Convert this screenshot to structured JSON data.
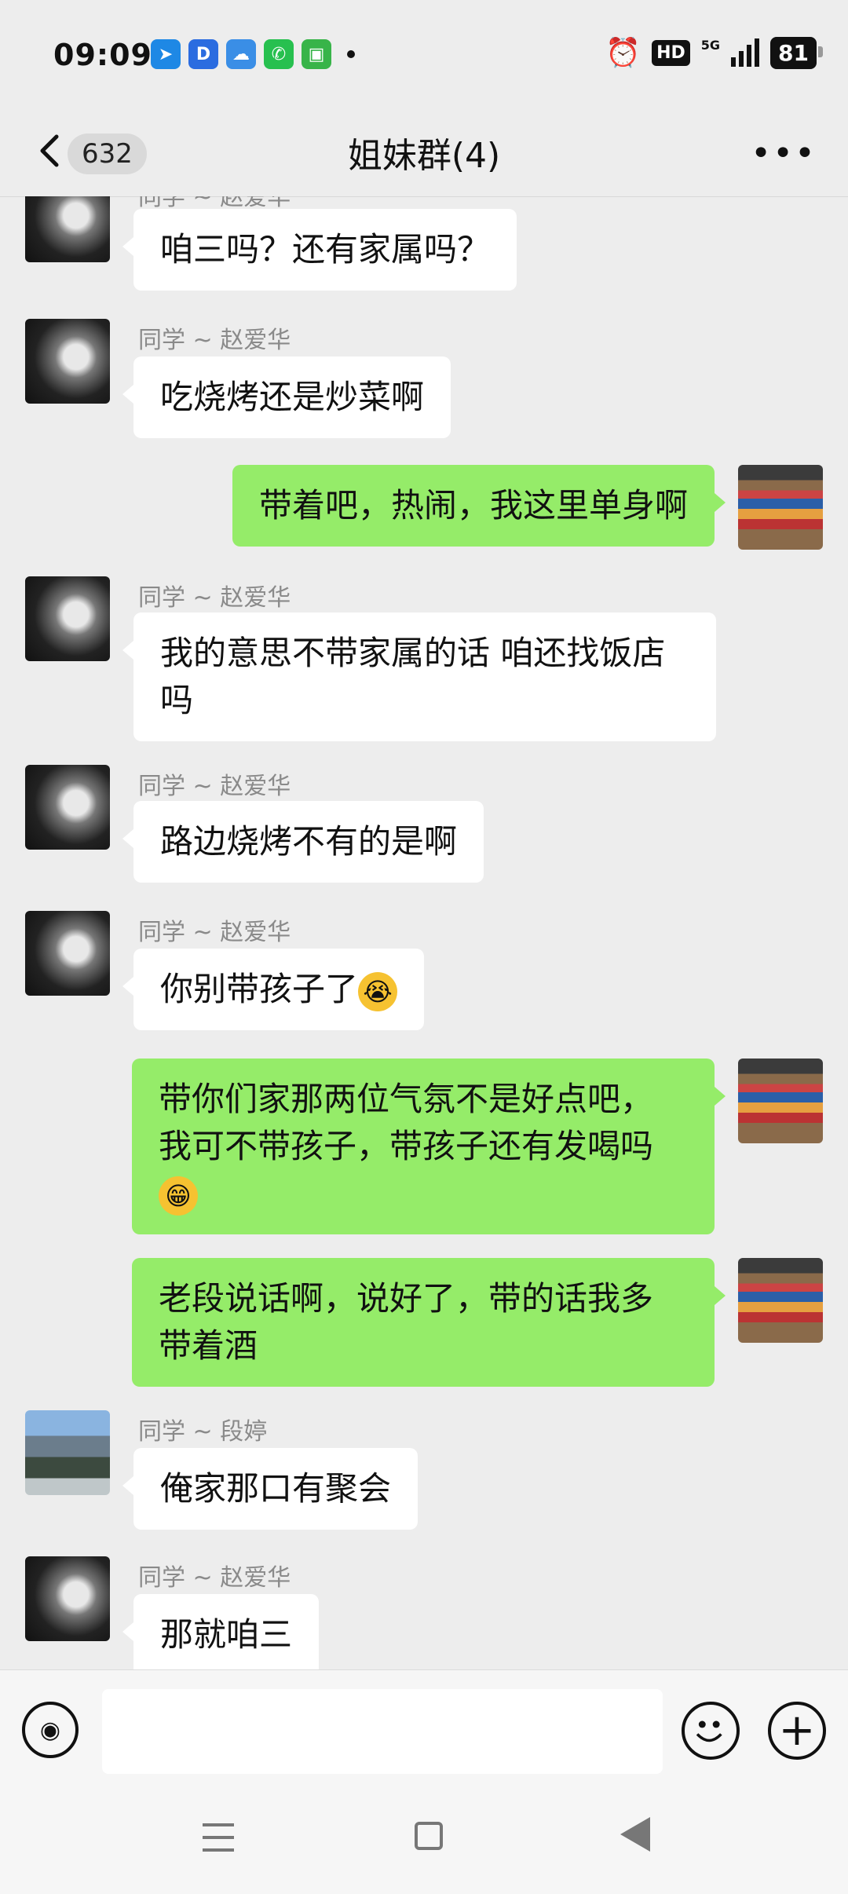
{
  "status_bar": {
    "time": "09:09",
    "network": "5G",
    "hd_label": "HD",
    "battery": "81"
  },
  "header": {
    "unread_count": "632",
    "title": "姐妹群(4)"
  },
  "messages": [
    {
      "side": "in",
      "sender": "同学 ~ 赵爱华",
      "text": "咱三吗？还有家属吗？",
      "avatar": "dark-portrait"
    },
    {
      "side": "in",
      "sender": "同学 ~ 赵爱华",
      "text": "吃烧烤还是炒菜啊",
      "avatar": "dark-portrait"
    },
    {
      "side": "out",
      "text": "带着吧，热闹，我这里单身啊",
      "avatar": "store-shelf"
    },
    {
      "side": "in",
      "sender": "同学 ~ 赵爱华",
      "text_line1": "我的意思不带家属的话 咱还找饭店",
      "text_line2": "吗",
      "avatar": "dark-portrait"
    },
    {
      "side": "in",
      "sender": "同学 ~ 赵爱华",
      "text": "路边烧烤不有的是啊",
      "avatar": "dark-portrait"
    },
    {
      "side": "in",
      "sender": "同学 ~ 赵爱华",
      "text": "你别带孩子了",
      "emoji": "😭",
      "avatar": "dark-portrait"
    },
    {
      "side": "out",
      "text_line1": "带你们家那两位气氛不是好点吧，",
      "text_line2": "我可不带孩子，带孩子还有发喝吗",
      "emoji": "😁",
      "avatar": "store-shelf"
    },
    {
      "side": "out",
      "text_line1": "老段说话啊，说好了，带的话我多",
      "text_line2": "带着酒",
      "avatar": "store-shelf"
    },
    {
      "side": "in",
      "sender": "同学 ~ 段婷",
      "text": "俺家那口有聚会",
      "avatar": "tree-landscape"
    },
    {
      "side": "in",
      "sender": "同学 ~ 赵爱华",
      "text": "那就咱三",
      "avatar": "dark-portrait"
    }
  ],
  "input_bar": {
    "placeholder": ""
  },
  "colors": {
    "outgoing_bubble": "#95ec69",
    "incoming_bubble": "#ffffff",
    "background": "#ededed"
  }
}
